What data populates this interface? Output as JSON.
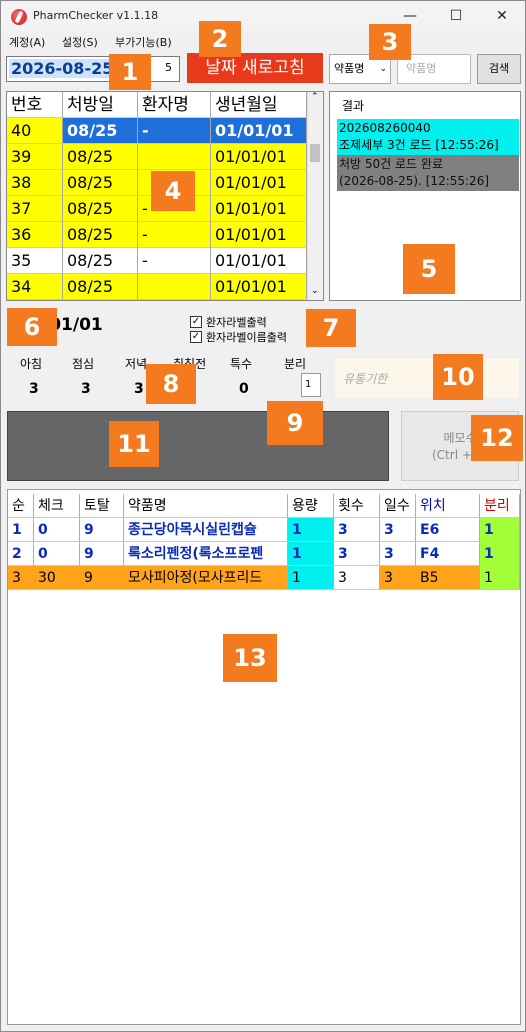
{
  "window": {
    "title": "PharmChecker v1.1.18",
    "minimize": "—",
    "maximize": "☐",
    "close": "✕"
  },
  "menu": [
    "계정(A)",
    "설정(S)",
    "부가기능(B)"
  ],
  "toolbar": {
    "date": "2026-08-25",
    "date_suffix": "5",
    "refresh_label": "날짜 새로고침",
    "drug_select": "약품명",
    "drug_input_placeholder": "약품명",
    "search_label": "검색"
  },
  "patients": {
    "headers": [
      "번호",
      "처방일",
      "환자명",
      "생년월일"
    ],
    "rows": [
      {
        "num": "40",
        "date": "08/25",
        "name": "-",
        "birth": "01/01/01",
        "style": "selected"
      },
      {
        "num": "39",
        "date": "08/25",
        "name": "",
        "birth": "01/01/01",
        "style": "yellow"
      },
      {
        "num": "38",
        "date": "08/25",
        "name": "",
        "birth": "01/01/01",
        "style": "yellow"
      },
      {
        "num": "37",
        "date": "08/25",
        "name": "-",
        "birth": "01/01/01",
        "style": "yellow"
      },
      {
        "num": "36",
        "date": "08/25",
        "name": "-",
        "birth": "01/01/01",
        "style": "yellow"
      },
      {
        "num": "35",
        "date": "08/25",
        "name": "-",
        "birth": "01/01/01",
        "style": "white"
      },
      {
        "num": "34",
        "date": "08/25",
        "name": "",
        "birth": "01/01/01",
        "style": "yellow"
      }
    ]
  },
  "results": {
    "header": "결과",
    "items": [
      {
        "line1": "202608260040",
        "line2": "조제세부 3건 로드",
        "time": "[12:55:26]"
      },
      {
        "line1": "처방 50건 로드 완료",
        "line2": "(2026-08-25).",
        "time": "[12:55:26]"
      }
    ]
  },
  "patient_birth": "/01/01",
  "checkboxes": [
    {
      "label": "환자라벨출력",
      "checked": true
    },
    {
      "label": "환자라벨이름출력",
      "checked": true
    }
  ],
  "meals": {
    "labels": [
      "아침",
      "점심",
      "저녁",
      "취침전",
      "특수"
    ],
    "values": [
      "3",
      "3",
      "3",
      "",
      "0"
    ],
    "bunri_label": "분리",
    "bunri_value": "1"
  },
  "expiry_placeholder": "유통기한",
  "memo": {
    "line1": "메모수",
    "line2": "(Ctrl + E)"
  },
  "drugs": {
    "headers": [
      "순",
      "체크",
      "토탈",
      "약품명",
      "용량",
      "횟수",
      "일수",
      "위치",
      "분리"
    ],
    "rows": [
      {
        "seq": "1",
        "check": "0",
        "total": "9",
        "name": "종근당아목시실린캡슐",
        "dose": "1",
        "times": "3",
        "days": "3",
        "loc": "E6",
        "split": "1",
        "style": "blue"
      },
      {
        "seq": "2",
        "check": "0",
        "total": "9",
        "name": "록소리펜정(록소프로펜",
        "dose": "1",
        "times": "3",
        "days": "3",
        "loc": "F4",
        "split": "1",
        "style": "blue"
      },
      {
        "seq": "3",
        "check": "30",
        "total": "9",
        "name": "모사피아정(모사프리드",
        "dose": "1",
        "times": "3",
        "days": "3",
        "loc": "B5",
        "split": "1",
        "style": "orange"
      }
    ]
  },
  "badges": [
    "1",
    "2",
    "3",
    "4",
    "5",
    "6",
    "7",
    "8",
    "9",
    "10",
    "11",
    "12",
    "13"
  ]
}
